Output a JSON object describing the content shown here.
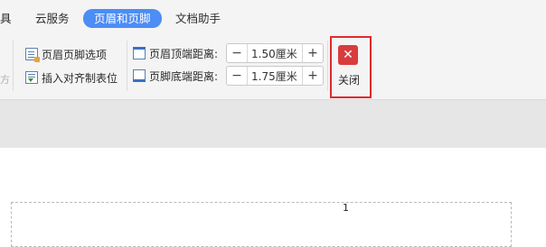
{
  "tabs": [
    {
      "label": "具"
    },
    {
      "label": "云服务"
    },
    {
      "label": "页眉和页脚",
      "active": true
    },
    {
      "label": "文档助手"
    }
  ],
  "ribbon": {
    "left_faint_char": "方",
    "header_footer_options": {
      "label": "页眉页脚选项",
      "icon": "header-footer-options-icon"
    },
    "insert_align_tab": {
      "label": "插入对齐制表位",
      "icon": "align-tab-icon"
    },
    "header_top_distance": {
      "label": "页眉顶端距离:",
      "value": "1.50厘米",
      "icon": "header-top-icon"
    },
    "footer_bottom_distance": {
      "label": "页脚底端距离:",
      "value": "1.75厘米",
      "icon": "footer-bottom-icon"
    },
    "stepper_minus": "−",
    "stepper_plus": "+",
    "close": {
      "label": "关闭",
      "glyph": "✕",
      "icon": "close-icon"
    }
  },
  "document": {
    "page_number": "1"
  },
  "colors": {
    "active_tab": "#4c8df6",
    "close_button": "#d83c3c",
    "highlight_box": "#e02a2a"
  }
}
